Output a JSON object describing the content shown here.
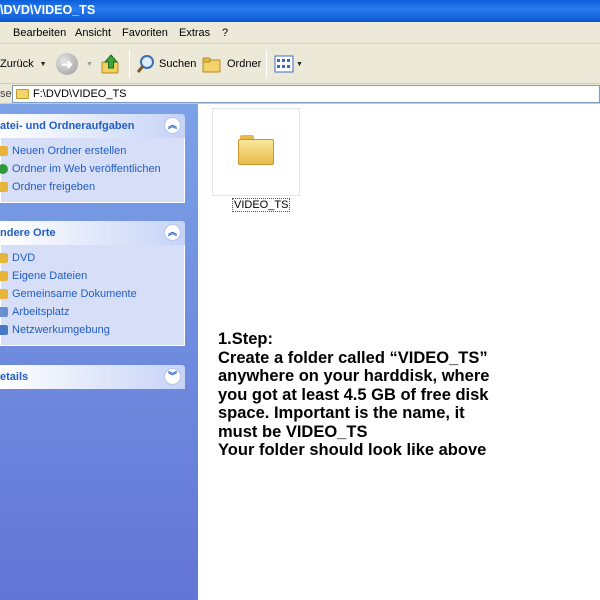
{
  "window": {
    "title": "\\DVD\\VIDEO_TS"
  },
  "menubar": {
    "items": [
      "Bearbeiten",
      "Ansicht",
      "Favoriten",
      "Extras",
      "?"
    ]
  },
  "toolbar": {
    "back_label": "Zurück",
    "search_label": "Suchen",
    "folders_label": "Ordner"
  },
  "address": {
    "label": "se",
    "path": "F:\\DVD\\VIDEO_TS"
  },
  "sidebar": {
    "tasks_title": "atei- und Ordneraufgaben",
    "tasks": [
      "Neuen Ordner erstellen",
      "Ordner im Web veröffentlichen",
      "Ordner freigeben"
    ],
    "places_title": "ndere Orte",
    "places": [
      "DVD",
      "Eigene Dateien",
      "Gemeinsame Dokumente",
      "Arbeitsplatz",
      "Netzwerkumgebung"
    ],
    "details_title": "etails",
    "collapse_glyph": "︽",
    "expand_glyph": "︾"
  },
  "content": {
    "folder_name": "VIDEO_TS",
    "instructions": [
      "1.Step:",
      "Create a folder called “VIDEO_TS”",
      "anywhere on your harddisk, where",
      "you got at least 4.5 GB of free disk",
      "space. Important is the name, it",
      "must be VIDEO_TS",
      "Your folder should look like above"
    ]
  },
  "colors": {
    "titlebar": "#0a5ed8",
    "sidebar_gradient_top": "#7ba2e7",
    "sidebar_gradient_bottom": "#6375d6",
    "link_blue": "#215dc6",
    "chrome": "#ece9d8"
  },
  "icons": {
    "back": "back-arrow-icon",
    "forward": "forward-arrow-icon",
    "up": "up-folder-icon",
    "search": "search-icon",
    "folders": "folders-icon",
    "views": "views-icon"
  }
}
